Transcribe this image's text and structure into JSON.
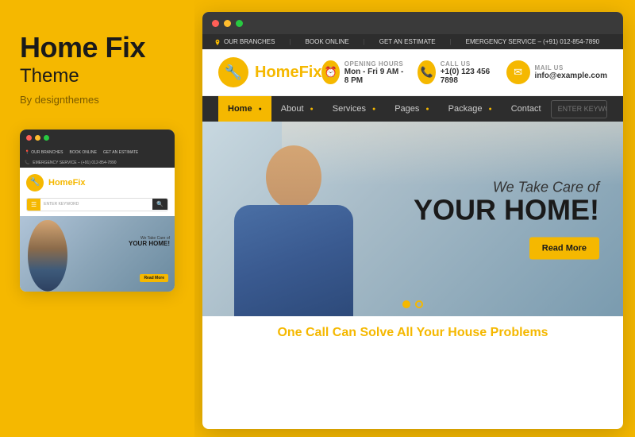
{
  "left": {
    "title": "Home Fix",
    "subtitle": "Theme",
    "byline": "By designthemes"
  },
  "small_browser": {
    "dots": [
      "red",
      "yellow",
      "green"
    ],
    "topbar_items": [
      "OUR BRANCHES",
      "BOOK ONLINE",
      "GET AN ESTIMATE",
      "EMERGENCY SERVICE – (+91) 012-854-7890"
    ],
    "logo_text": "Home",
    "logo_span": "Fix",
    "search_placeholder": "ENTER KEYWORD"
  },
  "small_hero": {
    "line1": "We Take Care of",
    "line2": "YOUR HOME!",
    "cta": "Read More"
  },
  "topbar": {
    "item1": "OUR BRANCHES",
    "item2": "BOOK ONLINE",
    "item3": "GET AN ESTIMATE",
    "item4": "EMERGENCY SERVICE – (+91) 012-854-7890"
  },
  "header": {
    "logo_text": "Home",
    "logo_span": "Fix",
    "logo_icon": "🔧",
    "info": [
      {
        "icon": "⏰",
        "label": "OPENING HOURS",
        "value": "Mon - Fri  9 AM - 8 PM"
      },
      {
        "icon": "📞",
        "label": "CALL US",
        "value": "+1(0) 123 456 7898"
      },
      {
        "icon": "✉",
        "label": "MAIL US",
        "value": "info@example.com"
      }
    ]
  },
  "nav": {
    "items": [
      "Home",
      "About",
      "Services",
      "Pages",
      "Package",
      "Contact"
    ],
    "active": "Home",
    "search_placeholder": "ENTER KEYWORD"
  },
  "hero": {
    "tagline": "We Take Care of",
    "headline": "YOUR HOME!",
    "cta": "Read More"
  },
  "bottom": {
    "text": "One Call Can Solve ",
    "highlight": "All Your House Problems"
  },
  "colors": {
    "accent": "#F5B800",
    "dark": "#2d2d2d",
    "text": "#1a1a1a"
  }
}
